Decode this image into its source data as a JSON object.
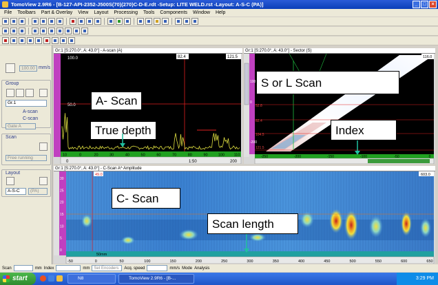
{
  "window": {
    "title": "TomoView 2.9R6 - [B-127-API-2352-J500S(70)(270)C-D-E.rdt -Setup: LITE WELD.rst -Layout: A-S-C     (PA)]",
    "min": "_",
    "max": "□",
    "close": "×"
  },
  "menu": [
    "File",
    "Toolbars",
    "Part & Overlay",
    "View",
    "Layout",
    "Processing",
    "Tools",
    "Components",
    "Window",
    "Help"
  ],
  "left_panel": {
    "speed_value": "100.00",
    "speed_unit": "mm/s",
    "group_label": "Group",
    "group_value": "Gr.1",
    "ascan_label": "A-scan",
    "cscan_label": "C-scan",
    "gate_value": "Gate A",
    "scan_label": "Scan",
    "scan_mode": "Free running",
    "layout_label": "Layout",
    "layout_value": "A-S-C",
    "layout_mode": "(PA)"
  },
  "ascan": {
    "title": "Gr:1 [S:270.0°, A: 43.0°] - A-scan (A)",
    "left_labels": [
      "100.0",
      "50.0"
    ],
    "gate_labels": [
      "82.4",
      "121.5"
    ],
    "axis_ticks": [
      "10",
      "0",
      "20",
      "30",
      "40",
      "50",
      "60",
      "70",
      "80",
      "90",
      "100",
      "110"
    ],
    "axis_unit": "mm",
    "bottom_ticks": [
      "0",
      "1:50",
      "200"
    ],
    "callout_main": "A- Scan",
    "callout_depth": "True depth"
  },
  "sector": {
    "title": "Gr:1 [S:270.0°, A: 43.0°] - Sector (S)",
    "top_right": "116.0",
    "left_ticks": [
      "100",
      "0",
      "-200"
    ],
    "right_labels": [
      "52.8",
      "82.4",
      "104.5",
      "121.5"
    ],
    "axis_ticks": [
      "-250",
      "-200",
      "-150",
      "-100",
      "-50",
      "0"
    ],
    "axis_unit": "mm",
    "callout_main": "S or L Scan",
    "callout_index": "Index"
  },
  "cscan": {
    "title": "Gr:1 [S:270.0°, A: 43.0°] - C-Scan A^ Amplitude",
    "top_left": "49.0",
    "top_right": "603.0",
    "left_ticks": [
      "30",
      "25",
      "20",
      "15",
      "10",
      "5",
      "0"
    ],
    "axis_ticks": [
      "-50",
      "0",
      "50",
      "100",
      "150",
      "200",
      "250",
      "300",
      "350",
      "400",
      "450",
      "500",
      "550",
      "600",
      "650"
    ],
    "axis_unit": "mm",
    "axis_unit_label": "50mm",
    "callout_main": "C- Scan",
    "callout_length": "Scan length"
  },
  "status": {
    "scan_label": "Scan",
    "unit1": "mm",
    "index_label": "Index",
    "unit2": "mm",
    "set_encoders": "Set Encoders",
    "acq_label": "Acq. speed",
    "unit3": "mm/s",
    "mode_label": "Mode",
    "mode_value": "Analysis"
  },
  "taskbar": {
    "start": "start",
    "task1": "N8",
    "task2": "TomoView 2.9R6 - [B-...",
    "time": "3:29 PM"
  },
  "colors": {
    "scan_bg": "#000000",
    "ascan_signal": "#e0e040",
    "gate_red": "#e02020",
    "cscan_base": "#3a7ac8",
    "axis_green": "#20a020"
  }
}
